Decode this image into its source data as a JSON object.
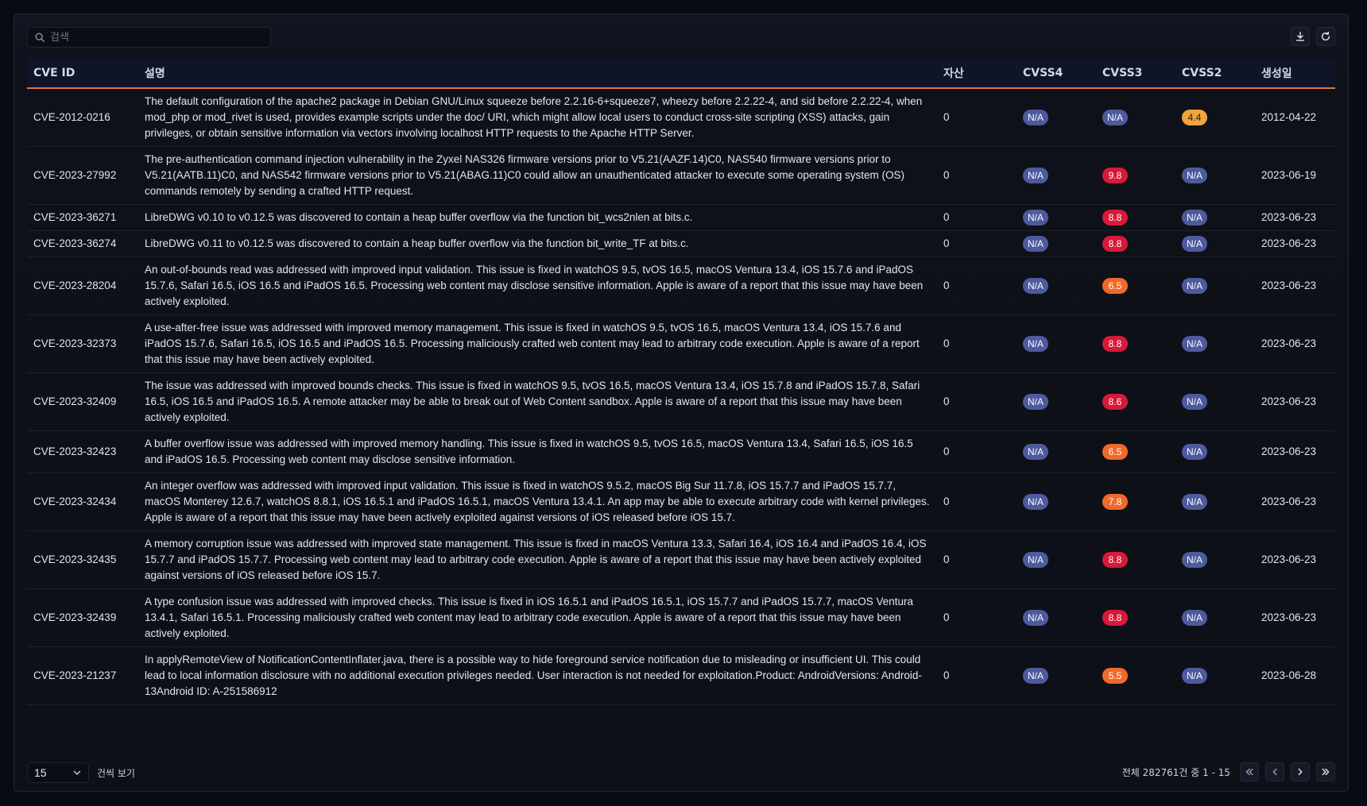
{
  "search": {
    "placeholder": "검색"
  },
  "table": {
    "headers": [
      "CVE ID",
      "설명",
      "자산",
      "CVSS4",
      "CVSS3",
      "CVSS2",
      "생성일"
    ],
    "rows": [
      {
        "id": "CVE-2012-0216",
        "desc": "The default configuration of the apache2 package in Debian GNU/Linux squeeze before 2.2.16-6+squeeze7, wheezy before 2.2.22-4, and sid before 2.2.22-4, when mod_php or mod_rivet is used, provides example scripts under the doc/ URI, which might allow local users to conduct cross-site scripting (XSS) attacks, gain privileges, or obtain sensitive information via vectors involving localhost HTTP requests to the Apache HTTP Server.",
        "asset": "0",
        "cvss4": "N/A",
        "cvss3": "N/A",
        "cvss2": "4.4",
        "date": "2012-04-22",
        "c4": "#4d5a9e",
        "c3": "#4d5a9e",
        "c2": "#f3a43a"
      },
      {
        "id": "CVE-2023-27992",
        "desc": "The pre-authentication command injection vulnerability in the Zyxel NAS326 firmware versions prior to V5.21(AAZF.14)C0, NAS540 firmware versions prior to V5.21(AATB.11)C0, and NAS542 firmware versions prior to V5.21(ABAG.11)C0 could allow an unauthenticated attacker to execute some operating system (OS) commands remotely by sending a crafted HTTP request.",
        "asset": "0",
        "cvss4": "N/A",
        "cvss3": "9.8",
        "cvss2": "N/A",
        "date": "2023-06-19",
        "c4": "#4d5a9e",
        "c3": "#d7193a",
        "c2": "#4d5a9e"
      },
      {
        "id": "CVE-2023-36271",
        "desc": "LibreDWG v0.10 to v0.12.5 was discovered to contain a heap buffer overflow via the function bit_wcs2nlen at bits.c.",
        "asset": "0",
        "cvss4": "N/A",
        "cvss3": "8.8",
        "cvss2": "N/A",
        "date": "2023-06-23",
        "c4": "#4d5a9e",
        "c3": "#d7193a",
        "c2": "#4d5a9e"
      },
      {
        "id": "CVE-2023-36274",
        "desc": "LibreDWG v0.11 to v0.12.5 was discovered to contain a heap buffer overflow via the function bit_write_TF at bits.c.",
        "asset": "0",
        "cvss4": "N/A",
        "cvss3": "8.8",
        "cvss2": "N/A",
        "date": "2023-06-23",
        "c4": "#4d5a9e",
        "c3": "#d7193a",
        "c2": "#4d5a9e"
      },
      {
        "id": "CVE-2023-28204",
        "desc": "An out-of-bounds read was addressed with improved input validation. This issue is fixed in watchOS 9.5, tvOS 16.5, macOS Ventura 13.4, iOS 15.7.6 and iPadOS 15.7.6, Safari 16.5, iOS 16.5 and iPadOS 16.5. Processing web content may disclose sensitive information. Apple is aware of a report that this issue may have been actively exploited.",
        "asset": "0",
        "cvss4": "N/A",
        "cvss3": "6.5",
        "cvss2": "N/A",
        "date": "2023-06-23",
        "c4": "#4d5a9e",
        "c3": "#ef6a2a",
        "c2": "#4d5a9e"
      },
      {
        "id": "CVE-2023-32373",
        "desc": "A use-after-free issue was addressed with improved memory management. This issue is fixed in watchOS 9.5, tvOS 16.5, macOS Ventura 13.4, iOS 15.7.6 and iPadOS 15.7.6, Safari 16.5, iOS 16.5 and iPadOS 16.5. Processing maliciously crafted web content may lead to arbitrary code execution. Apple is aware of a report that this issue may have been actively exploited.",
        "asset": "0",
        "cvss4": "N/A",
        "cvss3": "8.8",
        "cvss2": "N/A",
        "date": "2023-06-23",
        "c4": "#4d5a9e",
        "c3": "#d7193a",
        "c2": "#4d5a9e"
      },
      {
        "id": "CVE-2023-32409",
        "desc": "The issue was addressed with improved bounds checks. This issue is fixed in watchOS 9.5, tvOS 16.5, macOS Ventura 13.4, iOS 15.7.8 and iPadOS 15.7.8, Safari 16.5, iOS 16.5 and iPadOS 16.5. A remote attacker may be able to break out of Web Content sandbox. Apple is aware of a report that this issue may have been actively exploited.",
        "asset": "0",
        "cvss4": "N/A",
        "cvss3": "8.6",
        "cvss2": "N/A",
        "date": "2023-06-23",
        "c4": "#4d5a9e",
        "c3": "#d7193a",
        "c2": "#4d5a9e"
      },
      {
        "id": "CVE-2023-32423",
        "desc": "A buffer overflow issue was addressed with improved memory handling. This issue is fixed in watchOS 9.5, tvOS 16.5, macOS Ventura 13.4, Safari 16.5, iOS 16.5 and iPadOS 16.5. Processing web content may disclose sensitive information.",
        "asset": "0",
        "cvss4": "N/A",
        "cvss3": "6.5",
        "cvss2": "N/A",
        "date": "2023-06-23",
        "c4": "#4d5a9e",
        "c3": "#ef6a2a",
        "c2": "#4d5a9e"
      },
      {
        "id": "CVE-2023-32434",
        "desc": "An integer overflow was addressed with improved input validation. This issue is fixed in watchOS 9.5.2, macOS Big Sur 11.7.8, iOS 15.7.7 and iPadOS 15.7.7, macOS Monterey 12.6.7, watchOS 8.8.1, iOS 16.5.1 and iPadOS 16.5.1, macOS Ventura 13.4.1. An app may be able to execute arbitrary code with kernel privileges. Apple is aware of a report that this issue may have been actively exploited against versions of iOS released before iOS 15.7.",
        "asset": "0",
        "cvss4": "N/A",
        "cvss3": "7.8",
        "cvss2": "N/A",
        "date": "2023-06-23",
        "c4": "#4d5a9e",
        "c3": "#ef6a2a",
        "c2": "#4d5a9e"
      },
      {
        "id": "CVE-2023-32435",
        "desc": "A memory corruption issue was addressed with improved state management. This issue is fixed in macOS Ventura 13.3, Safari 16.4, iOS 16.4 and iPadOS 16.4, iOS 15.7.7 and iPadOS 15.7.7. Processing web content may lead to arbitrary code execution. Apple is aware of a report that this issue may have been actively exploited against versions of iOS released before iOS 15.7.",
        "asset": "0",
        "cvss4": "N/A",
        "cvss3": "8.8",
        "cvss2": "N/A",
        "date": "2023-06-23",
        "c4": "#4d5a9e",
        "c3": "#d7193a",
        "c2": "#4d5a9e"
      },
      {
        "id": "CVE-2023-32439",
        "desc": "A type confusion issue was addressed with improved checks. This issue is fixed in iOS 16.5.1 and iPadOS 16.5.1, iOS 15.7.7 and iPadOS 15.7.7, macOS Ventura 13.4.1, Safari 16.5.1. Processing maliciously crafted web content may lead to arbitrary code execution. Apple is aware of a report that this issue may have been actively exploited.",
        "asset": "0",
        "cvss4": "N/A",
        "cvss3": "8.8",
        "cvss2": "N/A",
        "date": "2023-06-23",
        "c4": "#4d5a9e",
        "c3": "#d7193a",
        "c2": "#4d5a9e"
      },
      {
        "id": "CVE-2023-21237",
        "desc": "In applyRemoteView of NotificationContentInflater.java, there is a possible way to hide foreground service notification due to misleading or insufficient UI. This could lead to local information disclosure with no additional execution privileges needed. User interaction is not needed for exploitation.Product: AndroidVersions: Android-13Android ID: A-251586912",
        "asset": "0",
        "cvss4": "N/A",
        "cvss3": "5.5",
        "cvss2": "N/A",
        "date": "2023-06-28",
        "c4": "#4d5a9e",
        "c3": "#ef6a2a",
        "c2": "#4d5a9e"
      }
    ]
  },
  "footer": {
    "page_size": "15",
    "per_page_label": "건씩 보기",
    "page_info": "전체 282761건 중 1 - 15"
  },
  "icons": {
    "search": "search-icon",
    "download": "download-icon",
    "refresh": "refresh-icon",
    "dropdown": "chevron-down-icon",
    "first": "chevrons-left-icon",
    "prev": "chevron-left-icon",
    "next": "chevron-right-icon",
    "last": "chevrons-right-icon"
  }
}
